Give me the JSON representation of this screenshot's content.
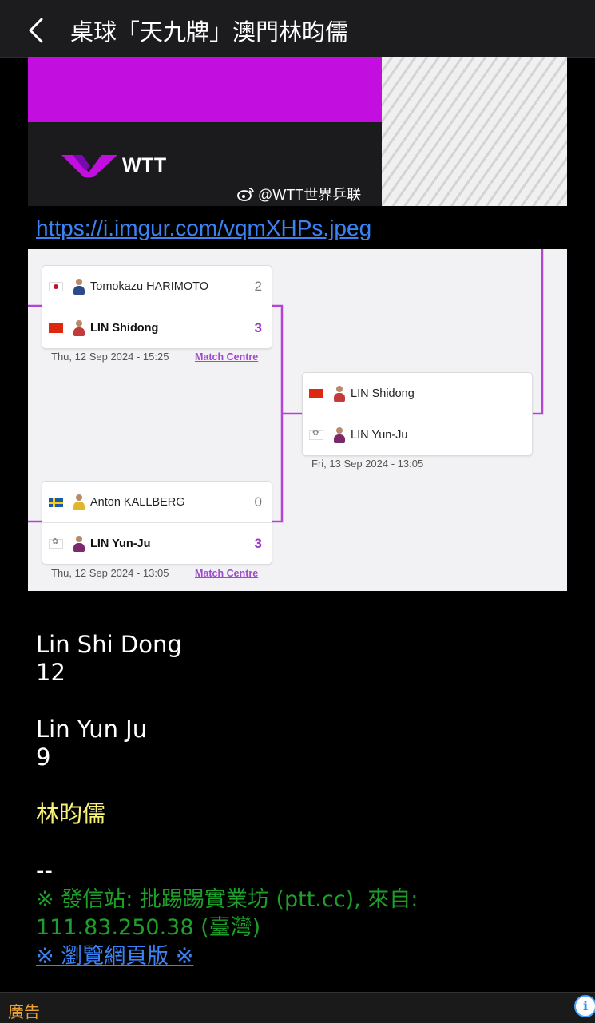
{
  "header": {
    "back_icon": "chevron-left-icon",
    "title": "桌球「天九牌」澳門林昀儒"
  },
  "banner": {
    "logo_text": "WTT",
    "weibo_handle": "@WTT世界乒联",
    "accent": "#c30ee0"
  },
  "image_link": "https://i.imgur.com/vqmXHPs.jpeg",
  "bracket": {
    "accent": "#a149d0",
    "matches": [
      {
        "players": [
          {
            "flag": "jp",
            "name": "Tomokazu HARIMOTO",
            "score": "2",
            "winner": false
          },
          {
            "flag": "cn",
            "name": "LIN Shidong",
            "score": "3",
            "winner": true
          }
        ],
        "date": "Thu, 12 Sep 2024 - 15:25",
        "match_centre": "Match Centre"
      },
      {
        "players": [
          {
            "flag": "se",
            "name": "Anton KALLBERG",
            "score": "0",
            "winner": false
          },
          {
            "flag": "tpe",
            "name": "LIN Yun-Ju",
            "score": "3",
            "winner": true
          }
        ],
        "date": "Thu, 12 Sep 2024 - 13:05",
        "match_centre": "Match Centre"
      },
      {
        "players": [
          {
            "flag": "cn",
            "name": "LIN Shidong",
            "score": "",
            "winner": false
          },
          {
            "flag": "tpe",
            "name": "LIN Yun-Ju",
            "score": "",
            "winner": false
          }
        ],
        "date": "Fri, 13 Sep 2024 - 13:05",
        "match_centre": ""
      }
    ]
  },
  "post": {
    "line1": "Lin Shi Dong",
    "line2": "12",
    "line3": "Lin Yun Ju",
    "line4": "9",
    "chinese_name": "林昀儒",
    "separator": "--",
    "source_line1": "※ 發信站: 批踢踢實業坊 (ptt.cc), 來自:",
    "source_line2": "111.83.250.38 (臺灣)",
    "browse_link": "※ 瀏覽網頁版 ※"
  },
  "footer": {
    "ad_label": "廣告",
    "info_icon": "info-icon"
  }
}
